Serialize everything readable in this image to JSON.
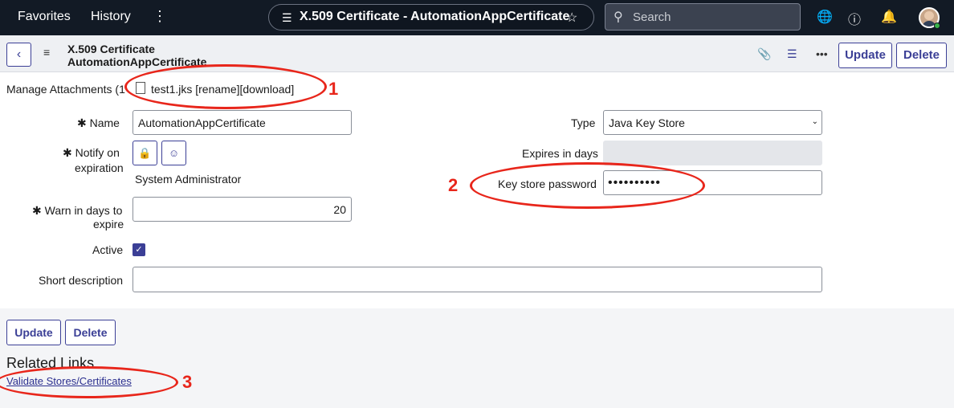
{
  "topnav": {
    "favorites": "Favorites",
    "history": "History",
    "more": "⋮",
    "record_title": "X.509 Certificate - AutomationAppCertificate",
    "search_placeholder": "Search"
  },
  "header": {
    "title_line1": "X.509 Certificate",
    "title_line2": "AutomationAppCertificate",
    "more": "•••",
    "update_label": "Update",
    "delete_label": "Delete"
  },
  "attachments": {
    "label": "Manage Attachments (1",
    "file": "test1.jks [rename][download]"
  },
  "form": {
    "name_label": "Name",
    "name_value": "AutomationAppCertificate",
    "notify_label_1": "Notify on",
    "notify_label_2": "expiration",
    "notify_value": "System Administrator",
    "warn_label_1": "Warn in days to",
    "warn_label_2": "expire",
    "warn_value": "20",
    "active_label": "Active",
    "active_checked": true,
    "short_desc_label": "Short description",
    "short_desc_value": "",
    "type_label": "Type",
    "type_value": "Java Key Store",
    "expires_label": "Expires in days",
    "expires_value": "",
    "keystore_label": "Key store password",
    "keystore_value": "••••••••••"
  },
  "footer": {
    "update_label": "Update",
    "delete_label": "Delete",
    "related_links": "Related Links",
    "validate_link": "Validate Stores/Certificates"
  },
  "annotations": {
    "n1": "1",
    "n2": "2",
    "n3": "3",
    "color": "#e8261b"
  },
  "colors": {
    "nav_bg": "#121a25",
    "accent": "#3b3f96"
  }
}
